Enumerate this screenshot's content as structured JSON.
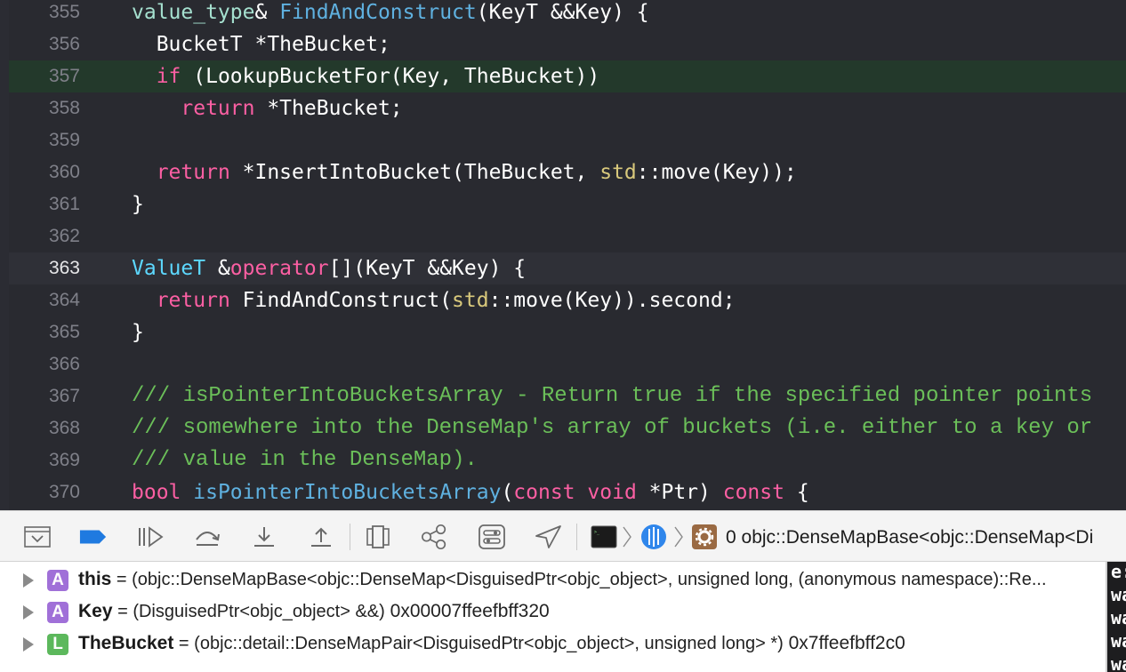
{
  "editor": {
    "lines": [
      {
        "num": "355",
        "segments": [
          [
            "value_type",
            "#a5e0cf"
          ],
          [
            "& ",
            "#ffffff"
          ],
          [
            "FindAndConstruct",
            "#5fb1e0"
          ],
          [
            "(KeyT &&Key) {",
            "#ffffff"
          ]
        ]
      },
      {
        "num": "356",
        "segments": [
          [
            "  BucketT *TheBucket;",
            "#ffffff"
          ]
        ]
      },
      {
        "num": "357",
        "segments": [
          [
            "  ",
            "#ffffff"
          ],
          [
            "if",
            "#fc5fa3"
          ],
          [
            " (LookupBucketFor(Key, TheBucket))",
            "#ffffff"
          ]
        ]
      },
      {
        "num": "358",
        "segments": [
          [
            "    ",
            "#ffffff"
          ],
          [
            "return",
            "#fc5fa3"
          ],
          [
            " *TheBucket;",
            "#ffffff"
          ]
        ]
      },
      {
        "num": "359",
        "segments": []
      },
      {
        "num": "360",
        "segments": [
          [
            "  ",
            "#ffffff"
          ],
          [
            "return",
            "#fc5fa3"
          ],
          [
            " *InsertIntoBucket(TheBucket, ",
            "#ffffff"
          ],
          [
            "std",
            "#d9c97c"
          ],
          [
            "::move(Key));",
            "#ffffff"
          ]
        ]
      },
      {
        "num": "361",
        "segments": [
          [
            "}",
            "#ffffff"
          ]
        ]
      },
      {
        "num": "362",
        "segments": []
      },
      {
        "num": "363",
        "segments": [
          [
            "ValueT",
            "#5dd8ff"
          ],
          [
            " &",
            "#ffffff"
          ],
          [
            "operator",
            "#fc5fa3"
          ],
          [
            "[](KeyT &&Key) {",
            "#ffffff"
          ]
        ]
      },
      {
        "num": "364",
        "segments": [
          [
            "  ",
            "#ffffff"
          ],
          [
            "return",
            "#fc5fa3"
          ],
          [
            " FindAndConstruct(",
            "#ffffff"
          ],
          [
            "std",
            "#d9c97c"
          ],
          [
            "::move(Key)).second;",
            "#ffffff"
          ]
        ]
      },
      {
        "num": "365",
        "segments": [
          [
            "}",
            "#ffffff"
          ]
        ]
      },
      {
        "num": "366",
        "segments": []
      },
      {
        "num": "367",
        "comment": true,
        "segments": [
          [
            "/// isPointerIntoBucketsArray - Return true if the specified pointer points",
            "#6bbf59"
          ]
        ]
      },
      {
        "num": "368",
        "comment": true,
        "segments": [
          [
            "/// somewhere into the DenseMap's array of buckets (i.e. either to a key or",
            "#6bbf59"
          ]
        ]
      },
      {
        "num": "369",
        "comment": true,
        "segments": [
          [
            "/// value in the DenseMap).",
            "#6bbf59"
          ]
        ]
      },
      {
        "num": "370",
        "segments": [
          [
            "bool",
            "#fc5fa3"
          ],
          [
            " ",
            "#ffffff"
          ],
          [
            "isPointerIntoBucketsArray",
            "#5fb1e0"
          ],
          [
            "(",
            "#ffffff"
          ],
          [
            "const",
            "#fc5fa3"
          ],
          [
            " ",
            "#ffffff"
          ],
          [
            "void",
            "#fc5fa3"
          ],
          [
            " *Ptr) ",
            "#ffffff"
          ],
          [
            "const",
            "#fc5fa3"
          ],
          [
            " {",
            "#ffffff"
          ]
        ]
      }
    ],
    "highlight_green_line": "357",
    "current_line": "363"
  },
  "debug_bar": {
    "frame_label": "0 objc::DenseMapBase<objc::DenseMap<Di",
    "buttons": [
      "hide-debug-area",
      "breakpoints-toggle",
      "continue",
      "step-over",
      "step-into",
      "step-out",
      "view-hierarchy",
      "memory-graph",
      "environment-overrides",
      "simulate-location"
    ]
  },
  "variables": [
    {
      "badge": "A",
      "badge_color": "#a070d8",
      "name": "this",
      "type": "(objc::DenseMapBase<objc::DenseMap<DisguisedPtr<objc_object>, unsigned long, (anonymous namespace)::Re...",
      "value": ""
    },
    {
      "badge": "A",
      "badge_color": "#a070d8",
      "name": "Key",
      "type": "(DisguisedPtr<objc_object> &&)",
      "value": "0x00007ffeefbff320"
    },
    {
      "badge": "L",
      "badge_color": "#5cb85c",
      "name": "TheBucket",
      "type": "(objc::detail::DenseMapPair<DisguisedPtr<objc_object>, unsigned long> *)",
      "value": "0x7ffeefbff2c0"
    }
  ],
  "console": {
    "lines": [
      "e:",
      "wa",
      "wa",
      "wa",
      "wa"
    ]
  }
}
